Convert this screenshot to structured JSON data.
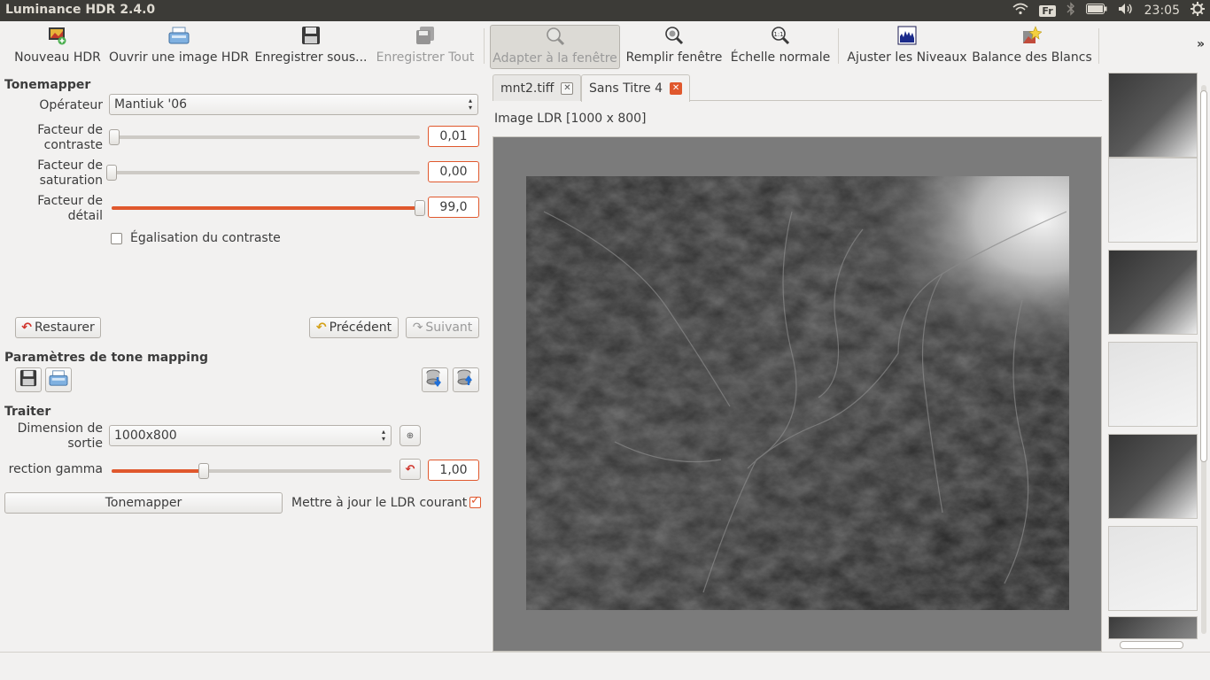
{
  "window": {
    "title": "Luminance HDR 2.4.0"
  },
  "tray": {
    "keyboard": "Fr",
    "clock": "23:05"
  },
  "toolbar": {
    "new_hdr": "Nouveau HDR",
    "open_hdr": "Ouvrir une image HDR",
    "save_as": "Enregistrer sous...",
    "save_all": "Enregistrer Tout",
    "fit_window": "Adapter à la fenêtre",
    "fill_window": "Remplir fenêtre",
    "normal_scale": "Échelle normale",
    "adjust_levels": "Ajuster les Niveaux",
    "white_balance": "Balance des Blancs",
    "more": "»"
  },
  "tonemapper": {
    "section_title": "Tonemapper",
    "operator_label": "Opérateur",
    "operator_value": "Mantiuk '06",
    "contrast_label_1": "Facteur de",
    "contrast_label_2": "contraste",
    "contrast_value": "0,01",
    "contrast_level": 0.01,
    "saturation_label_1": "Facteur de",
    "saturation_label_2": "saturation",
    "saturation_value": "0,00",
    "saturation_level": 0.0,
    "detail_label_1": "Facteur de",
    "detail_label_2": "détail",
    "detail_value": "99,0",
    "detail_level": 1.0,
    "equalize_label": "Égalisation du contraste",
    "equalize_checked": false,
    "reset_button": "Restaurer",
    "previous_button": "Précédent",
    "next_button": "Suivant"
  },
  "params": {
    "section_title": "Paramètres de tone mapping"
  },
  "process": {
    "section_title": "Traiter",
    "output_size_label_1": "Dimension de",
    "output_size_label_2": "sortie",
    "output_size_value": "1000x800",
    "gamma_label": "rection gamma",
    "gamma_value": "1,00",
    "gamma_level": 0.33,
    "tonemap_button": "Tonemapper",
    "update_ldr_label": "Mettre à jour le LDR courant",
    "update_ldr_checked": true
  },
  "tabs": [
    {
      "label": "mnt2.tiff"
    },
    {
      "label": "Sans Titre 4"
    }
  ],
  "viewer": {
    "image_label": "Image LDR [1000 x 800]"
  },
  "colors": {
    "accent": "#e0582d",
    "topbar": "#3c3b37",
    "viewport_bg": "#7b7b7b"
  }
}
